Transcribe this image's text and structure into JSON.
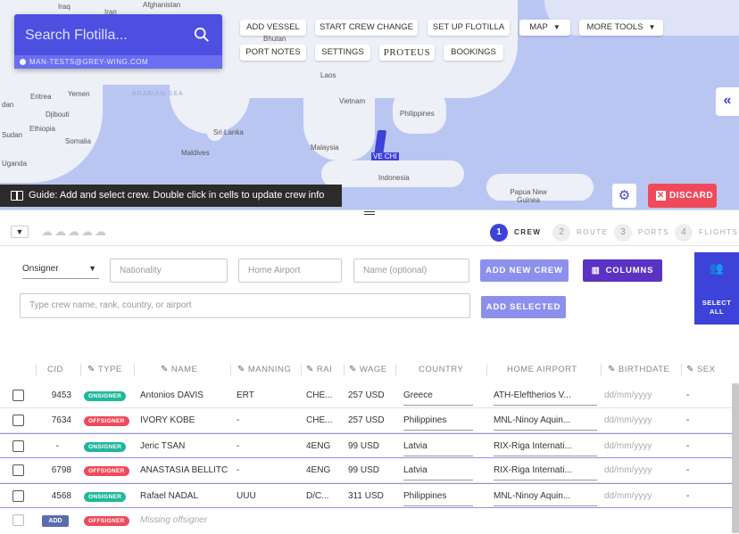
{
  "search": {
    "placeholder": "Search Flotilla...",
    "user": "MAN-TESTS@GREY-WING.COM"
  },
  "toolbar": {
    "add_vessel": "ADD VESSEL",
    "start_crew_change": "START CREW CHANGE",
    "set_up_flotilla": "SET UP FLOTILLA",
    "map": "MAP",
    "more_tools": "MORE TOOLS",
    "port_notes": "PORT NOTES",
    "settings": "SETTINGS",
    "proteus": "PROTEUS",
    "bookings": "BOOKINGS"
  },
  "map": {
    "labels": [
      "Afghanistan",
      "Iraq",
      "Iran",
      "Bhutan",
      "Yemen",
      "Eritrea",
      "Djibouti",
      "Ethiopia",
      "Somalia",
      "Sudan",
      "Uganda",
      "Laos",
      "Vietnam",
      "Philippines",
      "Sri Lanka",
      "Malaysia",
      "Maldives",
      "Indonesia",
      "Papua New Guinea",
      "ARABIAN SEA",
      "dan",
      "VE CHI"
    ]
  },
  "guide": {
    "text": "Guide: Add and select crew. Double click in cells to update crew info"
  },
  "discard_label": "DISCARD",
  "steps": [
    {
      "num": "1",
      "label": "CREW"
    },
    {
      "num": "2",
      "label": "ROUTE"
    },
    {
      "num": "3",
      "label": "PORTS"
    },
    {
      "num": "4",
      "label": "FLIGHTS"
    }
  ],
  "form": {
    "type_select": "Onsigner",
    "nationality_placeholder": "Nationality",
    "home_airport_placeholder": "Home Airport",
    "name_placeholder": "Name (optional)",
    "add_new_crew": "ADD NEW CREW",
    "columns": "COLUMNS",
    "crew_search_placeholder": "Type crew name, rank, country, or airport",
    "add_selected": "ADD SELECTED",
    "select_all": "SELECT ALL"
  },
  "table": {
    "headers": [
      "CID",
      "TYPE",
      "NAME",
      "MANNING",
      "RAI",
      "WAGE",
      "COUNTRY",
      "HOME AIRPORT",
      "BIRTHDATE",
      "SEX"
    ],
    "rows": [
      {
        "cid": "9453",
        "type": "ONSIGNER",
        "name": "Antonios DAVIS",
        "manning": "ERT",
        "rank": "CHE...",
        "wage": "257 USD",
        "country": "Greece",
        "airport": "ATH-Eleftherios V...",
        "birthdate": "dd/mm/yyyy",
        "sex": "-"
      },
      {
        "cid": "7634",
        "type": "OFFSIGNER",
        "name": "IVORY KOBE",
        "manning": "-",
        "rank": "CHE...",
        "wage": "257 USD",
        "country": "Philippines",
        "airport": "MNL-Ninoy Aquin...",
        "birthdate": "dd/mm/yyyy",
        "sex": "-"
      },
      {
        "cid": "-",
        "type": "ONSIGNER",
        "name": "Jeric TSAN",
        "manning": "-",
        "rank": "4ENG",
        "wage": "99 USD",
        "country": "Latvia",
        "airport": "RIX-Riga Internati...",
        "birthdate": "dd/mm/yyyy",
        "sex": "-"
      },
      {
        "cid": "6798",
        "type": "OFFSIGNER",
        "name": "ANASTASIA BELLITC",
        "manning": "-",
        "rank": "4ENG",
        "wage": "99 USD",
        "country": "Latvia",
        "airport": "RIX-Riga Internati...",
        "birthdate": "dd/mm/yyyy",
        "sex": "-"
      },
      {
        "cid": "4568",
        "type": "ONSIGNER",
        "name": "Rafael NADAL",
        "manning": "UUU",
        "rank": "D/C...",
        "wage": "311 USD",
        "country": "Philippines",
        "airport": "MNL-Ninoy Aquin...",
        "birthdate": "dd/mm/yyyy",
        "sex": "-"
      }
    ],
    "missing_row": {
      "add": "ADD",
      "type": "OFFSIGNER",
      "text": "Missing offsigner"
    }
  },
  "colors": {
    "accent": "#3d42d9",
    "onsigner": "#1fb89b",
    "offsigner": "#f04a5a",
    "columns_btn": "#5a33c4",
    "light_btn": "#8c90ec"
  }
}
